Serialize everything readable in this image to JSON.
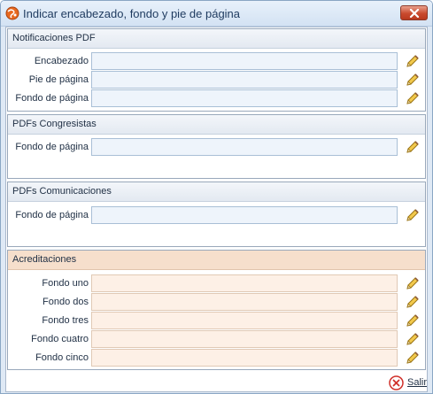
{
  "window": {
    "title": "Indicar encabezado, fondo y pie de página"
  },
  "sections": [
    {
      "title": "Notificaciones PDF",
      "fields": [
        {
          "label": "Encabezado",
          "value": ""
        },
        {
          "label": "Pie de página",
          "value": ""
        },
        {
          "label": "Fondo de página",
          "value": ""
        }
      ]
    },
    {
      "title": "PDFs Congresistas",
      "fields": [
        {
          "label": "Fondo de página",
          "value": ""
        }
      ]
    },
    {
      "title": "PDFs Comunicaciones",
      "fields": [
        {
          "label": "Fondo de página",
          "value": ""
        }
      ]
    },
    {
      "title": "Acreditaciones",
      "fields": [
        {
          "label": "Fondo uno",
          "value": ""
        },
        {
          "label": "Fondo dos",
          "value": ""
        },
        {
          "label": "Fondo tres",
          "value": ""
        },
        {
          "label": "Fondo cuatro",
          "value": ""
        },
        {
          "label": "Fondo cinco",
          "value": ""
        }
      ]
    }
  ],
  "footer": {
    "exit_label": "Salir"
  },
  "icons": {
    "app": "globe-icon",
    "close": "close-icon",
    "edit": "pencil-icon",
    "exit": "exit-x-icon"
  },
  "colors": {
    "peach_section": "#f6dfcc",
    "input_blue": "#eef4fb",
    "input_peach": "#fdf0e6",
    "close_red": "#c94a2e"
  }
}
